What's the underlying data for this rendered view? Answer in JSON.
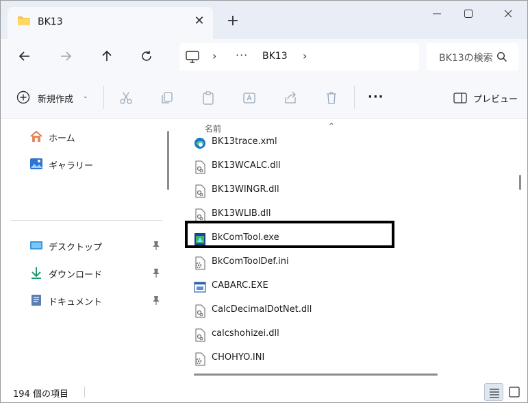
{
  "tab": {
    "title": "BK13",
    "close_glyph": "✕",
    "new_tab_glyph": "+"
  },
  "address": {
    "separator": "›",
    "overflow": "···",
    "crumb": "BK13",
    "search_placeholder": "BK13の検索"
  },
  "commands": {
    "new_label": "新規作成",
    "new_chevron": "⌄",
    "more": "···",
    "preview_label": "プレビュー"
  },
  "nav": {
    "home": "ホーム",
    "gallery": "ギャラリー",
    "desktop": "デスクトップ",
    "downloads": "ダウンロード",
    "documents": "ドキュメント"
  },
  "files": {
    "column_name": "名前",
    "sort_glyph": "⌃",
    "items": [
      {
        "name": "BK13trace.xml",
        "icon": "edge-xml-icon"
      },
      {
        "name": "BK13WCALC.dll",
        "icon": "dll-file-icon"
      },
      {
        "name": "BK13WINGR.dll",
        "icon": "dll-file-icon"
      },
      {
        "name": "BK13WLIB.dll",
        "icon": "dll-file-icon"
      },
      {
        "name": "BkComTool.exe",
        "icon": "app-exe-icon"
      },
      {
        "name": "BkComToolDef.ini",
        "icon": "ini-file-icon"
      },
      {
        "name": "CABARC.EXE",
        "icon": "window-exe-icon"
      },
      {
        "name": "CalcDecimalDotNet.dll",
        "icon": "dll-file-icon"
      },
      {
        "name": "calcshohizei.dll",
        "icon": "dll-file-icon"
      },
      {
        "name": "CHOHYO.INI",
        "icon": "ini-file-icon"
      }
    ],
    "highlighted_item": "BkComTool.exe"
  },
  "status": {
    "item_count": "194 個の項目"
  },
  "colors": {
    "titlebar": "#e9eef6",
    "toolbar": "#f6f8fb",
    "highlight_border": "#000000",
    "folder": "#f5c242",
    "accent_blue": "#2f74d0"
  }
}
